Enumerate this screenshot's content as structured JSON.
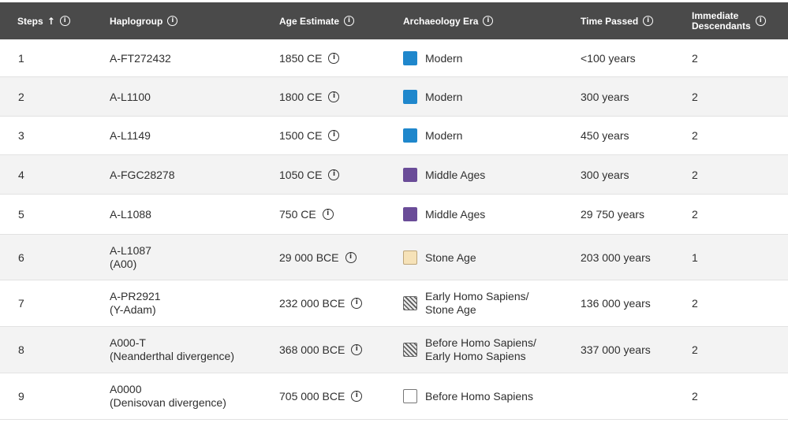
{
  "table": {
    "headers": {
      "steps": "Steps",
      "sort_arrow": "↑",
      "haplogroup": "Haplogroup",
      "age": "Age Estimate",
      "era": "Archaeology Era",
      "time": "Time Passed",
      "desc_line1": "Immediate",
      "desc_line2": "Descendants",
      "info_glyph": "i"
    },
    "era_colors": {
      "modern": "#1f87cc",
      "middle_ages": "#6a4c98",
      "stone_age": "#f6e2b8",
      "early_homo_sapiens": "hatched",
      "before_homo_sapiens": "#ffffff"
    },
    "rows": [
      {
        "step": "1",
        "hap": "A-FT272432",
        "hap2": "",
        "age": "1850 CE",
        "era": "Modern",
        "era2": "",
        "swatch": "modern",
        "time": "<100 years",
        "desc": "2"
      },
      {
        "step": "2",
        "hap": "A-L1100",
        "hap2": "",
        "age": "1800 CE",
        "era": "Modern",
        "era2": "",
        "swatch": "modern",
        "time": "300 years",
        "desc": "2"
      },
      {
        "step": "3",
        "hap": "A-L1149",
        "hap2": "",
        "age": "1500 CE",
        "era": "Modern",
        "era2": "",
        "swatch": "modern",
        "time": "450 years",
        "desc": "2"
      },
      {
        "step": "4",
        "hap": "A-FGC28278",
        "hap2": "",
        "age": "1050 CE",
        "era": "Middle Ages",
        "era2": "",
        "swatch": "middle",
        "time": "300 years",
        "desc": "2"
      },
      {
        "step": "5",
        "hap": "A-L1088",
        "hap2": "",
        "age": "750 CE",
        "era": "Middle Ages",
        "era2": "",
        "swatch": "middle",
        "time": "29 750 years",
        "desc": "2"
      },
      {
        "step": "6",
        "hap": "A-L1087",
        "hap2": "(A00)",
        "age": "29 000 BCE",
        "era": "Stone Age",
        "era2": "",
        "swatch": "stone",
        "time": "203 000 years",
        "desc": "1"
      },
      {
        "step": "7",
        "hap": "A-PR2921",
        "hap2": "(Y-Adam)",
        "age": "232 000 BCE",
        "era": "Early Homo Sapiens/",
        "era2": "Stone Age",
        "swatch": "hatch",
        "time": "136 000 years",
        "desc": "2"
      },
      {
        "step": "8",
        "hap": "A000-T",
        "hap2": "(Neanderthal divergence)",
        "age": "368 000 BCE",
        "era": "Before Homo Sapiens/",
        "era2": "Early Homo Sapiens",
        "swatch": "hatch",
        "time": "337 000 years",
        "desc": "2"
      },
      {
        "step": "9",
        "hap": "A0000",
        "hap2": "(Denisovan divergence)",
        "age": "705 000 BCE",
        "era": "Before Homo Sapiens",
        "era2": "",
        "swatch": "empty",
        "time": "",
        "desc": "2"
      }
    ]
  }
}
